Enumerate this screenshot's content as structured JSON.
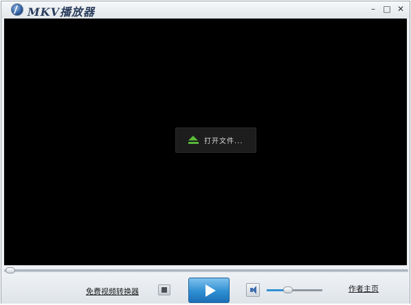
{
  "app": {
    "title": "MKV播放器",
    "icon": "player-logo-icon"
  },
  "window_controls": {
    "minimize": "–",
    "maximize": "□",
    "close": "✕"
  },
  "video": {
    "open_file_label": "打开文件...",
    "open_file_icon": "eject-icon",
    "accent": "#59b83a"
  },
  "playback": {
    "progress_fraction": 0.0
  },
  "controls": {
    "converter_link": "免费视频转换器",
    "author_link": "作者主页",
    "volume_fraction": 0.3,
    "play_color": "#2f8fd3"
  }
}
